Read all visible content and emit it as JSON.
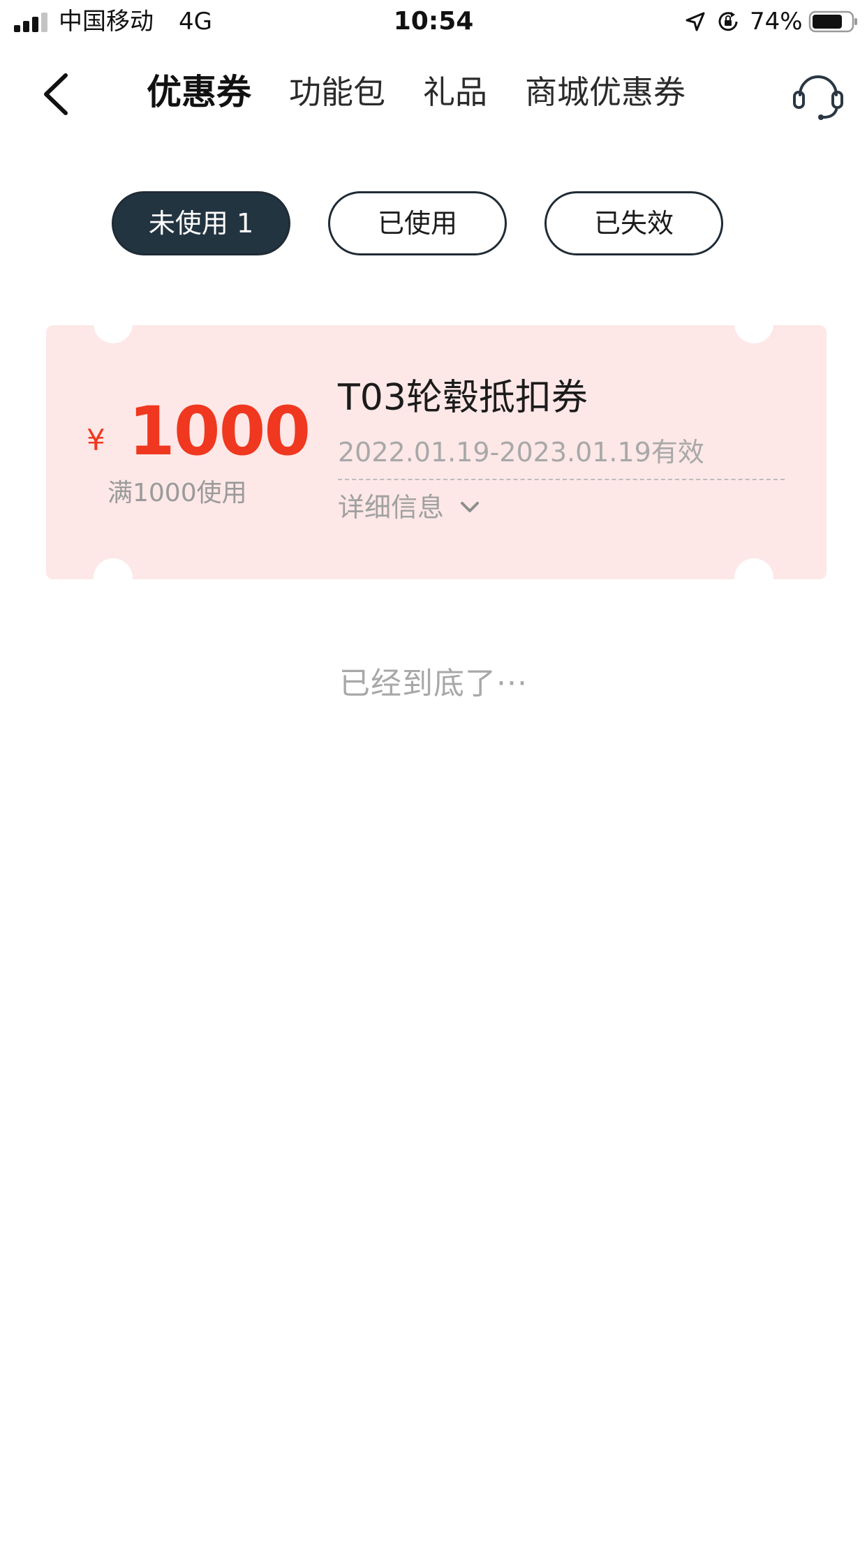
{
  "status_bar": {
    "carrier": "中国移动",
    "network": "4G",
    "time": "10:54",
    "battery_percent": "74%",
    "icons": [
      "signal-icon",
      "location-arrow-icon",
      "rotation-lock-icon",
      "battery-icon"
    ]
  },
  "nav": {
    "back_icon": "chevron-left-icon",
    "tabs": [
      {
        "label": "优惠券",
        "active": true
      },
      {
        "label": "功能包",
        "active": false
      },
      {
        "label": "礼品",
        "active": false
      },
      {
        "label": "商城优惠券",
        "active": false
      }
    ],
    "support_icon": "headset-icon"
  },
  "filters": [
    {
      "label": "未使用 1",
      "active": true
    },
    {
      "label": "已使用",
      "active": false
    },
    {
      "label": "已失效",
      "active": false
    }
  ],
  "coupon": {
    "currency": "¥",
    "amount": "1000",
    "condition": "满1000使用",
    "title": "T03轮毂抵扣券",
    "validity": "2022.01.19-2023.01.19有效",
    "details_label": "详细信息",
    "details_icon": "chevron-down-icon"
  },
  "end_of_list": "已经到底了···",
  "colors": {
    "accent_red": "#f0371f",
    "pill_active": "#233441",
    "coupon_bg": "#fde7e7"
  }
}
